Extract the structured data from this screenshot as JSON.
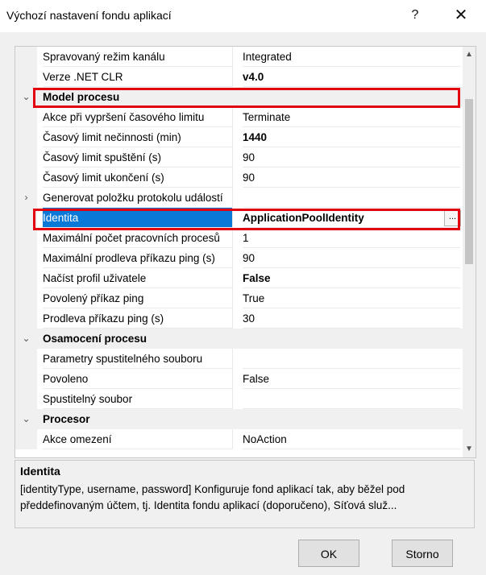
{
  "window": {
    "title": "Výchozí nastavení fondu aplikací",
    "help_glyph": "?",
    "close_glyph": "✕"
  },
  "grid": {
    "rows": [
      {
        "name": "Spravovaný režim kanálu",
        "value": "Integrated"
      },
      {
        "name": "Verze .NET CLR",
        "value": "v4.0"
      },
      {
        "name": "Model procesu"
      },
      {
        "name": "Akce při vypršení časového limitu",
        "value": "Terminate"
      },
      {
        "name": "Časový limit nečinnosti (min)",
        "value": "1440"
      },
      {
        "name": "Časový limit spuštění (s)",
        "value": "90"
      },
      {
        "name": "Časový limit ukončení (s)",
        "value": "90"
      },
      {
        "name": "Generovat položku protokolu událostí",
        "value": ""
      },
      {
        "name": "Identita",
        "value": "ApplicationPoolIdentity"
      },
      {
        "name": "Maximální počet pracovních procesů",
        "value": "1"
      },
      {
        "name": "Maximální prodleva příkazu ping (s)",
        "value": "90"
      },
      {
        "name": "Načíst profil uživatele",
        "value": "False"
      },
      {
        "name": "Povolený příkaz ping",
        "value": "True"
      },
      {
        "name": "Prodleva příkazu ping (s)",
        "value": "30"
      },
      {
        "name": "Osamocení procesu"
      },
      {
        "name": "Parametry spustitelného souboru",
        "value": ""
      },
      {
        "name": "Povoleno",
        "value": "False"
      },
      {
        "name": "Spustitelný soubor",
        "value": ""
      },
      {
        "name": "Procesor"
      },
      {
        "name": "Akce omezení",
        "value": "NoAction"
      }
    ],
    "glyphs": {
      "expanded": "⌄",
      "collapsed": "›",
      "ellipsis": "...",
      "scroll_up": "▲",
      "scroll_down": "▼"
    }
  },
  "description": {
    "title": "Identita",
    "text": "[identityType, username, password] Konfiguruje fond aplikací tak, aby běžel pod předdefinovaným účtem, tj. Identita fondu aplikací (doporučeno), Síťová služ..."
  },
  "buttons": {
    "ok": "OK",
    "cancel": "Storno"
  },
  "colors": {
    "selection": "#0a78d7",
    "highlight": "#e3000f"
  }
}
